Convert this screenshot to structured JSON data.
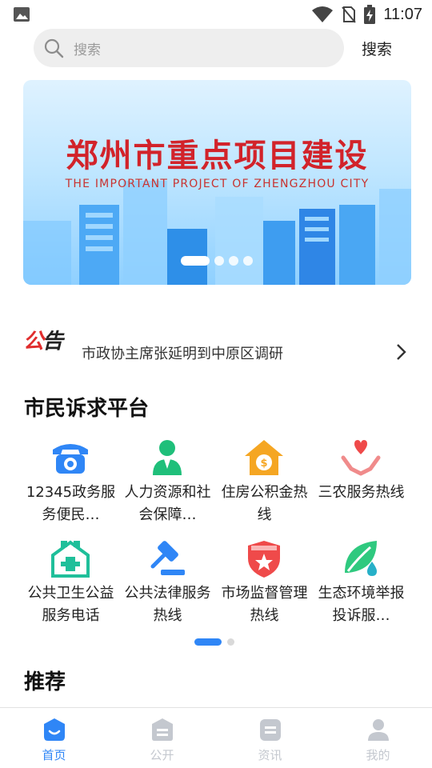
{
  "status_bar": {
    "time": "11:07",
    "icons": [
      "gallery-icon",
      "wifi-icon",
      "no-sim-icon",
      "battery-charging-icon"
    ]
  },
  "search": {
    "placeholder": "搜索",
    "button_label": "搜索"
  },
  "banner": {
    "title": "郑州市重点项目建设",
    "subtitle": "THE IMPORTANT PROJECT OF ZHENGZHOU CITY",
    "page_count": 4,
    "active_page": 1
  },
  "notice": {
    "logo": "公告",
    "text": "市政协主席张延明到中原区调研"
  },
  "platform": {
    "title": "市民诉求平台",
    "items": [
      {
        "label": "12345政务服务便民…",
        "icon": "telephone-icon"
      },
      {
        "label": "人力资源和社会保障…",
        "icon": "person-icon"
      },
      {
        "label": "住房公积金热线",
        "icon": "house-coin-icon"
      },
      {
        "label": "三农服务热线",
        "icon": "hand-heart-icon"
      },
      {
        "label": "公共卫生公益服务电话",
        "icon": "health-house-icon"
      },
      {
        "label": "公共法律服务热线",
        "icon": "gavel-icon"
      },
      {
        "label": "市场监督管理热线",
        "icon": "shield-star-icon"
      },
      {
        "label": "生态环境举报投诉服…",
        "icon": "leaf-icon"
      }
    ],
    "pager": {
      "pages": 2,
      "active": 1
    }
  },
  "recommend": {
    "title": "推荐"
  },
  "tabs": [
    {
      "label": "首页",
      "icon": "home-icon",
      "active": true
    },
    {
      "label": "公开",
      "icon": "document-icon",
      "active": false
    },
    {
      "label": "资讯",
      "icon": "news-icon",
      "active": false
    },
    {
      "label": "我的",
      "icon": "user-icon",
      "active": false
    }
  ],
  "colors": {
    "accent": "#2f86f6",
    "notice_red": "#e02d2d",
    "banner_title": "#d2232a",
    "tab_inactive": "#c4c8cf"
  }
}
